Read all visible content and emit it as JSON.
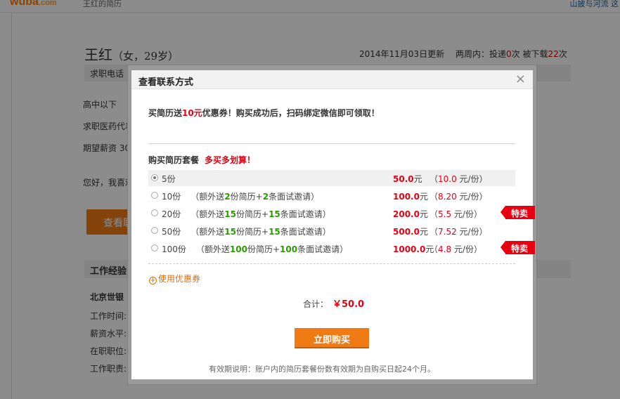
{
  "site": {
    "logo": "wuba",
    "logo_suffix": ".com",
    "subtitle": "王红的简历",
    "top_right_link": "山披与河流 这"
  },
  "resume": {
    "name": "王红",
    "meta": "（女，29岁）",
    "updated": "2014年11月03日更新",
    "stats": {
      "prefix": "两周内：投递",
      "delivered": "0",
      "mid": "次  被下载",
      "downloads": "22",
      "suffix": "次"
    },
    "phone_bar": "求职电话",
    "edu": "高中以下",
    "job": "求职医药代表",
    "salary": "期望薪资 30",
    "greeting": "您好，我喜欢",
    "view_button": "查看联",
    "work_heading": "工作经验",
    "work_company": "北京世银",
    "work_labels": [
      "工作时间:",
      "薪资水平:",
      "在职职位:",
      "工作职责:"
    ]
  },
  "modal": {
    "title": "查看联系方式",
    "close": "×",
    "promo": {
      "pre": "买简历送",
      "amount": "10元",
      "post": "优惠券！购买成功后，扫码绑定微信即可领取！"
    },
    "pkg_heading": "购买简历套餐",
    "pkg_heading_red": "多买多划算！",
    "packages": [
      {
        "count": "5份",
        "extra_pre": "",
        "res": "",
        "mid": "",
        "inv": "",
        "extra_post": "",
        "price": "50.0",
        "price_unit": "元",
        "unit_pre": "（",
        "unit_val": "10.0",
        "unit_post": " 元/份）",
        "tag": ""
      },
      {
        "count": "10份",
        "extra_pre": "（额外送",
        "res": "2",
        "mid": "份简历+",
        "inv": "2",
        "extra_post": "条面试邀请）",
        "price": "100.0",
        "price_unit": "元",
        "unit_pre": "（",
        "unit_val": "8.20",
        "unit_post": " 元/份）",
        "tag": ""
      },
      {
        "count": "20份",
        "extra_pre": "（额外送",
        "res": "15",
        "mid": "份简历+",
        "inv": "15",
        "extra_post": "条面试邀请）",
        "price": "200.0",
        "price_unit": "元",
        "unit_pre": "（",
        "unit_val": "5.5",
        "unit_post": " 元/份）",
        "tag": "特卖"
      },
      {
        "count": "50份",
        "extra_pre": "（额外送",
        "res": "15",
        "mid": "份简历+",
        "inv": "15",
        "extra_post": "条面试邀请）",
        "price": "500.0",
        "price_unit": "元",
        "unit_pre": "（",
        "unit_val": "7.52",
        "unit_post": " 元/份）",
        "tag": ""
      },
      {
        "count": "100份",
        "extra_pre": "（额外送",
        "res": "100",
        "mid": "份简历+",
        "inv": "100",
        "extra_post": "条面试邀请）",
        "price": "1000.0",
        "price_unit": "元",
        "unit_pre": "（",
        "unit_val": "4.8",
        "unit_post": " 元/份）",
        "tag": "特卖"
      }
    ],
    "selected_index": 0,
    "coupon_icon": "+",
    "coupon_label": "使用优惠券",
    "total_label": "合计：",
    "total_value": "￥50.0",
    "buy_button": "立即购买",
    "footnote": "有效期说明：账户内的简历套餐份数有效期为自购买日起24个月。"
  },
  "colors": {
    "accent_orange": "#f07a13",
    "price_red": "#e60012",
    "bonus_green": "#2a9a00"
  }
}
